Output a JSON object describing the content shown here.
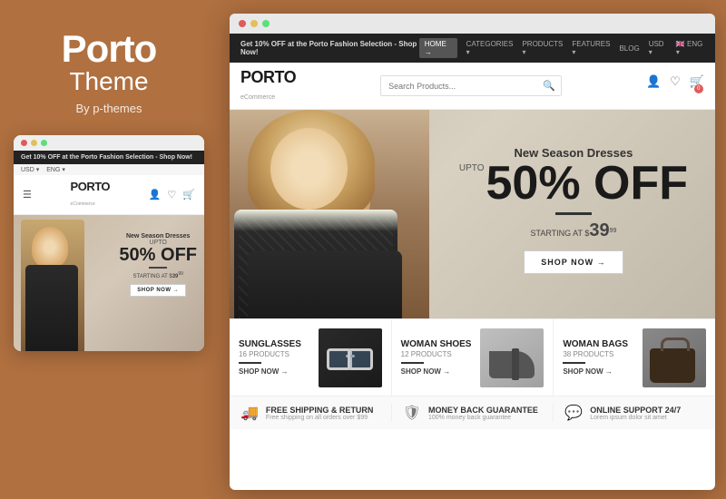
{
  "brand": {
    "title": "Porto",
    "subtitle": "Theme",
    "by": "By p-themes"
  },
  "browser": {
    "titlebar_dots": [
      "red",
      "yellow",
      "green"
    ]
  },
  "site": {
    "topbar": {
      "promo_text": "Get 10% OFF at the Porto Fashion Selection - ",
      "promo_cta": "Shop Now!",
      "nav_items": [
        "HOME →",
        "CATEGORIES →",
        "PRODUCTS →",
        "FEATURES →",
        "BLOG",
        "USD →",
        "ENG →"
      ]
    },
    "logo": "PORTO",
    "logo_sub": "eCommerce",
    "search_placeholder": "Search Products...",
    "hero": {
      "new_season": "New Season Dresses",
      "upto": "UPTO",
      "big_off": "50% OFF",
      "starting_label": "STARTING AT $",
      "price": "39",
      "price_cents": "99",
      "shop_btn": "SHOP NOW →"
    },
    "categories": [
      {
        "name": "SUNGLASSES",
        "products": "16 PRODUCTS",
        "shop": "SHOP NOW →",
        "type": "sunglasses"
      },
      {
        "name": "WOMAN SHOES",
        "products": "12 PRODUCTS",
        "shop": "SHOP NOW →",
        "type": "shoes"
      },
      {
        "name": "WOMAN BAGS",
        "products": "38 PRODUCTS",
        "shop": "SHOP NOW →",
        "type": "bags"
      }
    ],
    "footer_items": [
      {
        "icon": "🚚",
        "title": "FREE SHIPPING & RETURN",
        "desc": "Free shipping on all orders over $99"
      },
      {
        "icon": "🛡",
        "title": "MONEY BACK GUARANTEE",
        "desc": "100% money back guarantee"
      },
      {
        "icon": "💬",
        "title": "ONLINE SUPPORT 24/7",
        "desc": "Lorem ipsum dolor sit amet"
      }
    ]
  },
  "mobile": {
    "topbar_promo": "Get 10% OFF at the Porto Fashion Selection - ",
    "topbar_cta": "Shop Now!",
    "lang": "USD ▾",
    "flag": "ENG ▾",
    "logo": "PORTO",
    "logo_sub": "eCommerce",
    "hero_new_season": "New Season Dresses",
    "hero_upto": "UPTO",
    "hero_big_off": "50% OFF",
    "hero_starting": "STARTING AT $",
    "hero_price": "39",
    "hero_cents": "99",
    "hero_shop": "SHOP NOW →"
  }
}
